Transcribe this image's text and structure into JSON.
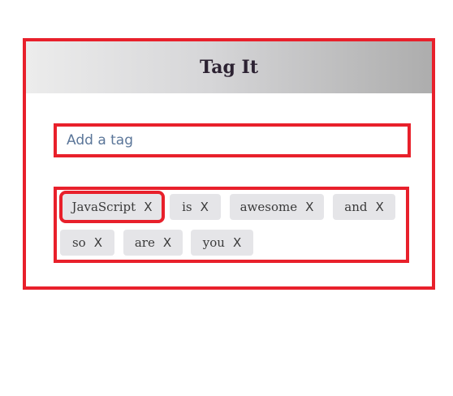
{
  "header": {
    "title": "Tag It"
  },
  "input": {
    "placeholder": "Add a tag",
    "value": ""
  },
  "tags": [
    {
      "label": "JavaScript",
      "remove": "X",
      "selected": true
    },
    {
      "label": "is",
      "remove": "X",
      "selected": false
    },
    {
      "label": "awesome",
      "remove": "X",
      "selected": false
    },
    {
      "label": "and",
      "remove": "X",
      "selected": false
    },
    {
      "label": "so",
      "remove": "X",
      "selected": false
    },
    {
      "label": "are",
      "remove": "X",
      "selected": false
    },
    {
      "label": "you",
      "remove": "X",
      "selected": false
    }
  ],
  "colors": {
    "highlight": "#e8202b",
    "tag_background": "#e5e5e8",
    "placeholder": "#5b7699",
    "title": "#2c2232"
  }
}
